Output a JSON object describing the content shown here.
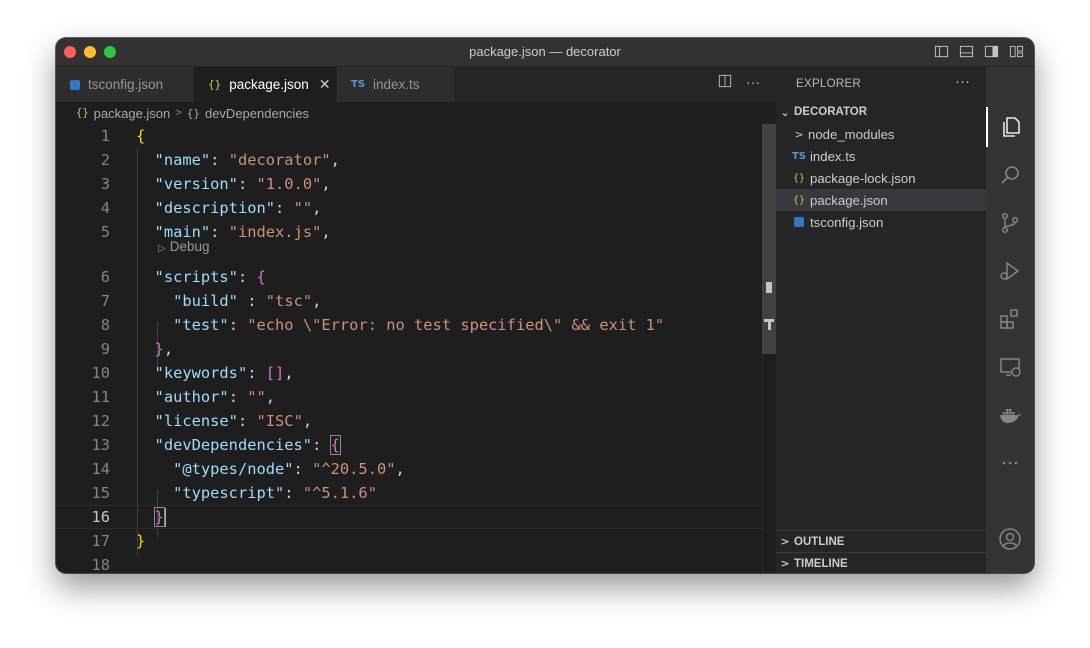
{
  "window": {
    "title": "package.json — decorator"
  },
  "tabs": [
    {
      "label": "tsconfig.json",
      "icon": "tsconfig-icon"
    },
    {
      "label": "package.json",
      "icon": "json-braces-icon",
      "active": true
    },
    {
      "label": "index.ts",
      "icon": "ts-icon"
    }
  ],
  "icon_text": {
    "json": "{}",
    "ts": "TS",
    "chevron": ">",
    "down": "⌄",
    "play": "▷",
    "more": "···"
  },
  "breadcrumb": {
    "file": "package.json",
    "symbol": "devDependencies"
  },
  "editor": {
    "codelens": "Debug",
    "current_line": 16,
    "line_numbers": [
      "1",
      "2",
      "3",
      "4",
      "5",
      "6",
      "7",
      "8",
      "9",
      "10",
      "11",
      "12",
      "13",
      "14",
      "15",
      "16",
      "17",
      "18"
    ],
    "lines": [
      [
        [
          "b1",
          "{"
        ]
      ],
      [
        [
          "p",
          "  "
        ],
        [
          "k",
          "\"name\""
        ],
        [
          "p",
          ": "
        ],
        [
          "s",
          "\"decorator\""
        ],
        [
          "p",
          ","
        ]
      ],
      [
        [
          "p",
          "  "
        ],
        [
          "k",
          "\"version\""
        ],
        [
          "p",
          ": "
        ],
        [
          "s",
          "\"1.0.0\""
        ],
        [
          "p",
          ","
        ]
      ],
      [
        [
          "p",
          "  "
        ],
        [
          "k",
          "\"description\""
        ],
        [
          "p",
          ": "
        ],
        [
          "s",
          "\"\""
        ],
        [
          "p",
          ","
        ]
      ],
      [
        [
          "p",
          "  "
        ],
        [
          "k",
          "\"main\""
        ],
        [
          "p",
          ": "
        ],
        [
          "s",
          "\"index.js\""
        ],
        [
          "p",
          ","
        ]
      ],
      [
        [
          "p",
          "  "
        ],
        [
          "k",
          "\"scripts\""
        ],
        [
          "p",
          ": "
        ],
        [
          "b2",
          "{"
        ]
      ],
      [
        [
          "p",
          "    "
        ],
        [
          "k",
          "\"build\""
        ],
        [
          "p",
          " : "
        ],
        [
          "s",
          "\"tsc\""
        ],
        [
          "p",
          ","
        ]
      ],
      [
        [
          "p",
          "    "
        ],
        [
          "k",
          "\"test\""
        ],
        [
          "p",
          ": "
        ],
        [
          "s",
          "\"echo \\\"Error: no test specified\\\" && exit 1\""
        ]
      ],
      [
        [
          "p",
          "  "
        ],
        [
          "b2",
          "}"
        ],
        [
          "p",
          ","
        ]
      ],
      [
        [
          "p",
          "  "
        ],
        [
          "k",
          "\"keywords\""
        ],
        [
          "p",
          ": "
        ],
        [
          "b2",
          "[]"
        ],
        [
          "p",
          ","
        ]
      ],
      [
        [
          "p",
          "  "
        ],
        [
          "k",
          "\"author\""
        ],
        [
          "p",
          ": "
        ],
        [
          "s",
          "\"\""
        ],
        [
          "p",
          ","
        ]
      ],
      [
        [
          "p",
          "  "
        ],
        [
          "k",
          "\"license\""
        ],
        [
          "p",
          ": "
        ],
        [
          "s",
          "\"ISC\""
        ],
        [
          "p",
          ","
        ]
      ],
      [
        [
          "p",
          "  "
        ],
        [
          "k",
          "\"devDependencies\""
        ],
        [
          "p",
          ": "
        ],
        [
          "b2box",
          "{"
        ]
      ],
      [
        [
          "p",
          "    "
        ],
        [
          "k",
          "\"@types/node\""
        ],
        [
          "p",
          ": "
        ],
        [
          "s",
          "\"^20.5.0\""
        ],
        [
          "p",
          ","
        ]
      ],
      [
        [
          "p",
          "    "
        ],
        [
          "k",
          "\"typescript\""
        ],
        [
          "p",
          ": "
        ],
        [
          "s",
          "\"^5.1.6\""
        ]
      ],
      [
        [
          "p",
          "  "
        ],
        [
          "b2box",
          "}"
        ],
        [
          "cursor",
          ""
        ]
      ],
      [
        [
          "b1",
          "}"
        ]
      ],
      []
    ]
  },
  "explorer": {
    "header": "EXPLORER",
    "folder": "DECORATOR",
    "items": [
      {
        "label": "node_modules",
        "type": "folder"
      },
      {
        "label": "index.ts",
        "type": "ts"
      },
      {
        "label": "package-lock.json",
        "type": "json"
      },
      {
        "label": "package.json",
        "type": "json",
        "selected": true
      },
      {
        "label": "tsconfig.json",
        "type": "tsconfig"
      }
    ],
    "sections": [
      "OUTLINE",
      "TIMELINE"
    ]
  },
  "activity_bar": [
    "explorer-icon",
    "search-icon",
    "source-control-icon",
    "run-debug-icon",
    "extensions-icon",
    "remote-explorer-icon",
    "docker-icon",
    "more-icon",
    "accounts-icon",
    "manage-gear-icon"
  ]
}
